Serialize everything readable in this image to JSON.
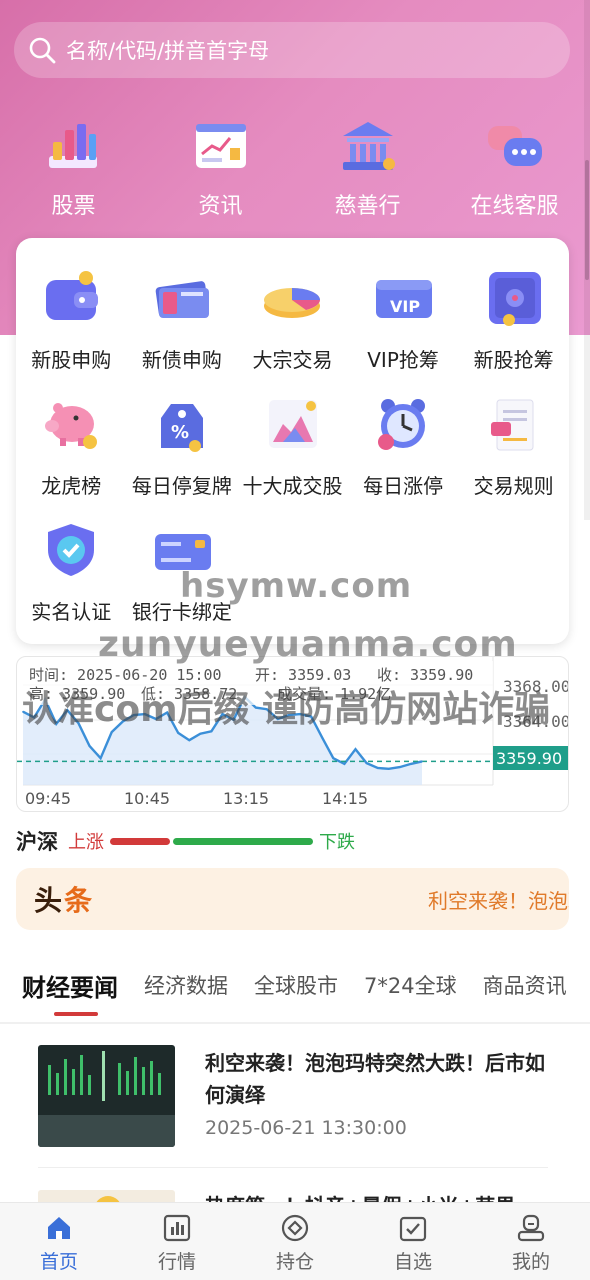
{
  "search": {
    "placeholder": "名称/代码/拼音首字母"
  },
  "top_nav": [
    {
      "label": "股票",
      "icon": "stock-chart-icon"
    },
    {
      "label": "资讯",
      "icon": "news-board-icon"
    },
    {
      "label": "慈善行",
      "icon": "bank-building-icon"
    },
    {
      "label": "在线客服",
      "icon": "chat-bubbles-icon"
    }
  ],
  "grid_items": [
    {
      "label": "新股申购",
      "icon": "wallet-icon"
    },
    {
      "label": "新债申购",
      "icon": "money-stack-icon"
    },
    {
      "label": "大宗交易",
      "icon": "pie-chart-icon"
    },
    {
      "label": "VIP抢筹",
      "icon": "vip-card-icon"
    },
    {
      "label": "新股抢筹",
      "icon": "safe-box-icon"
    },
    {
      "label": "龙虎榜",
      "icon": "piggy-bank-icon"
    },
    {
      "label": "每日停复牌",
      "icon": "discount-tag-icon"
    },
    {
      "label": "十大成交股",
      "icon": "mountain-chart-icon"
    },
    {
      "label": "每日涨停",
      "icon": "alarm-clock-icon"
    },
    {
      "label": "交易规则",
      "icon": "receipt-icon"
    },
    {
      "label": "实名认证",
      "icon": "shield-check-icon"
    },
    {
      "label": "银行卡绑定",
      "icon": "bank-card-icon"
    }
  ],
  "chart": {
    "info": {
      "time": "时间: 2025-06-20 15:00",
      "open": "开: 3359.03",
      "close": "收: 3359.90",
      "high": "高: 3359.90",
      "low": "低: 3358.72",
      "volume": "成交量: 1.92亿"
    },
    "y_ticks": [
      "3368.00",
      "3364.00"
    ],
    "current_price": "3359.90",
    "x_ticks": [
      "09:45",
      "10:45",
      "13:15",
      "14:15"
    ]
  },
  "chart_data": {
    "type": "area",
    "title": "",
    "xlabel": "",
    "ylabel": "",
    "x_ticks": [
      "09:45",
      "10:45",
      "13:15",
      "14:15"
    ],
    "ylim": [
      3357.5,
      3370.5
    ],
    "reference_line": 3359.9,
    "values": [
      3366.0,
      3365.3,
      3367.5,
      3364.5,
      3366.2,
      3364.6,
      3361.8,
      3360.3,
      3363.5,
      3364.8,
      3365.6,
      3365.7,
      3365.1,
      3365.9,
      3363.4,
      3362.5,
      3363.3,
      3363.6,
      3365.7,
      3365.0,
      3367.8,
      3366.5,
      3366.3,
      3365.1,
      3365.6,
      3365.7,
      3365.4,
      3362.8,
      3360.3,
      3359.6,
      3361.4,
      3359.7,
      3359.1,
      3359.0,
      3359.2,
      3359.6,
      3359.9
    ]
  },
  "market_bar": {
    "title": "沪深",
    "up_label": "上涨",
    "down_label": "下跌",
    "up_ratio": 0.3
  },
  "headline": {
    "logo_a": "头",
    "logo_b": "条",
    "ticker": "利空来袭！泡泡玛特突然大跌！后市如何演绎"
  },
  "tabs": [
    "财经要闻",
    "经济数据",
    "全球股市",
    "7*24全球",
    "商品资讯"
  ],
  "news": [
    {
      "title": "利空来袭！泡泡玛特突然大跌！后市如何演绎",
      "date": "2025-06-21 13:30:00"
    },
    {
      "title": "热度第一！抖音+暑假+小米+苹果",
      "date": ""
    }
  ],
  "bottom_nav": [
    {
      "label": "首页",
      "icon": "home-icon",
      "active": true
    },
    {
      "label": "行情",
      "icon": "bar-chart-icon",
      "active": false
    },
    {
      "label": "持仓",
      "icon": "target-icon",
      "active": false
    },
    {
      "label": "自选",
      "icon": "check-box-icon",
      "active": false
    },
    {
      "label": "我的",
      "icon": "user-icon",
      "active": false
    }
  ],
  "watermarks": [
    "hsymw.com",
    "zunyueyuanma.com",
    "认准com后缀 谨防高仿网站诈骗"
  ],
  "colors": {
    "accent": "#3a6fd8",
    "up": "#d23a3a",
    "down": "#2eaa4a",
    "hero": "#e58cc0",
    "price_tag": "#1f9e8a"
  }
}
